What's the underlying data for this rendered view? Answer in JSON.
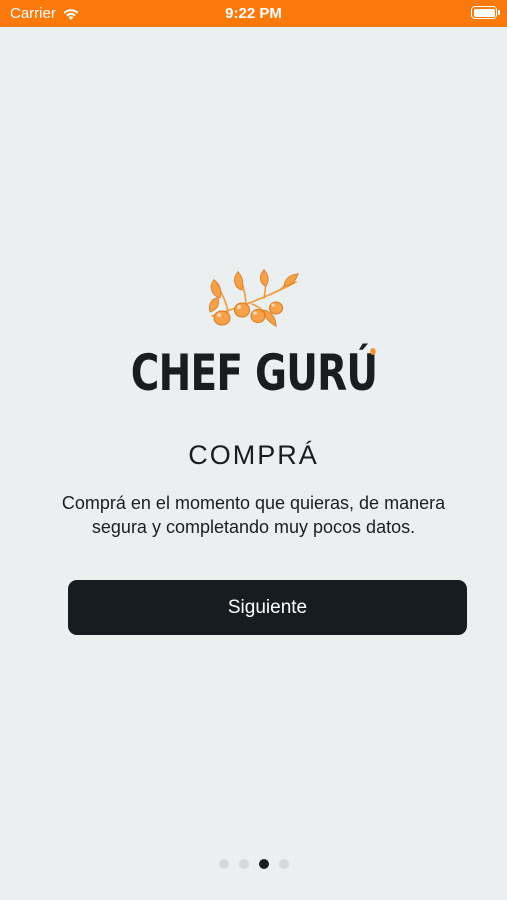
{
  "status_bar": {
    "carrier": "Carrier",
    "time": "9:22 PM"
  },
  "brand": {
    "name": "CHEF GURÚ",
    "accent_color": "#f6932a"
  },
  "onboarding": {
    "title": "COMPRÁ",
    "description": "Comprá en el momento que quieras, de manera segura y completando muy pocos datos.",
    "next_button_label": "Siguiente",
    "page_count": 4,
    "current_page": 3
  },
  "colors": {
    "status_bar": "#fb7a0b",
    "background": "#ebeff0",
    "button": "#171c21"
  },
  "icons": {
    "wifi": "wifi-icon",
    "battery": "battery-icon",
    "logo": "olive-branch-icon"
  }
}
